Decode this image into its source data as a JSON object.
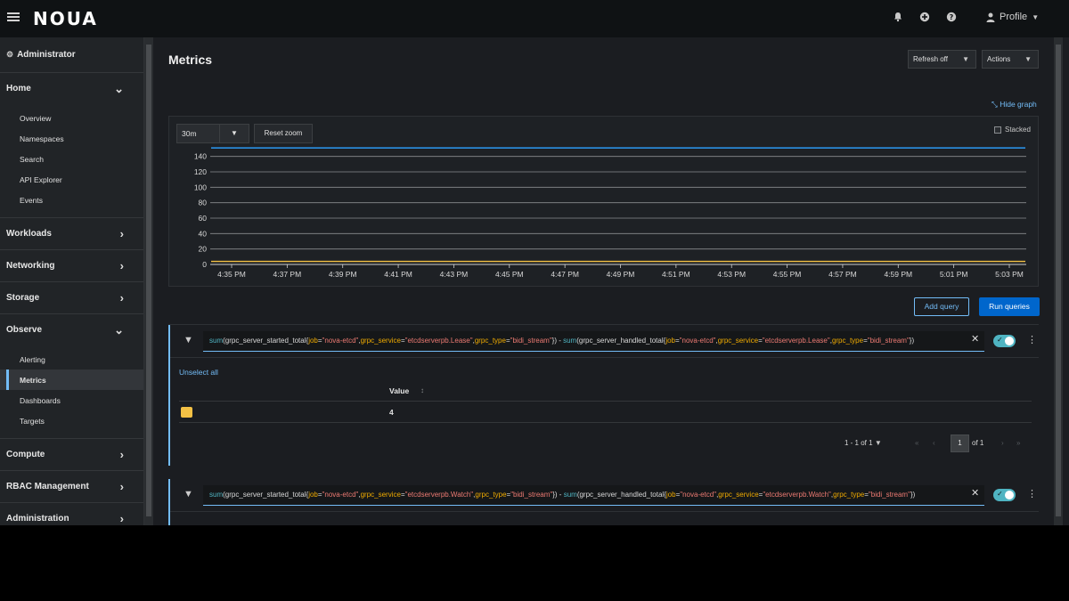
{
  "masthead": {
    "logo": "NOUA",
    "profile_label": "Profile"
  },
  "sidebar": {
    "perspective": "Administrator",
    "groups": [
      {
        "label": "Home",
        "expanded": true,
        "items": [
          "Overview",
          "Namespaces",
          "Search",
          "API Explorer",
          "Events"
        ]
      },
      {
        "label": "Workloads",
        "expanded": false,
        "items": []
      },
      {
        "label": "Networking",
        "expanded": false,
        "items": []
      },
      {
        "label": "Storage",
        "expanded": false,
        "items": []
      },
      {
        "label": "Observe",
        "expanded": true,
        "items": [
          "Alerting",
          "Metrics",
          "Dashboards",
          "Targets"
        ],
        "active": "Metrics"
      },
      {
        "label": "Compute",
        "expanded": false,
        "items": []
      },
      {
        "label": "RBAC Management",
        "expanded": false,
        "items": []
      },
      {
        "label": "Administration",
        "expanded": false,
        "items": []
      }
    ]
  },
  "page": {
    "title": "Metrics",
    "refresh_label": "Refresh off",
    "actions_label": "Actions",
    "hide_graph_label": "Hide graph",
    "time_span": "30m",
    "reset_zoom_label": "Reset zoom",
    "stacked_label": "Stacked",
    "add_query_label": "Add query",
    "run_queries_label": "Run queries"
  },
  "chart_data": {
    "type": "line",
    "title": "",
    "xlabel": "",
    "ylabel": "",
    "x_ticks": [
      "4:35 PM",
      "4:37 PM",
      "4:39 PM",
      "4:41 PM",
      "4:43 PM",
      "4:45 PM",
      "4:47 PM",
      "4:49 PM",
      "4:51 PM",
      "4:53 PM",
      "4:55 PM",
      "4:57 PM",
      "4:59 PM",
      "5:01 PM",
      "5:03 PM"
    ],
    "y_ticks": [
      0,
      20,
      40,
      60,
      80,
      100,
      120,
      140
    ],
    "ylim": [
      0,
      150
    ],
    "grid": true,
    "series": [
      {
        "color": "#2b9af3",
        "values": [
          151,
          151,
          151,
          151,
          151,
          151,
          151,
          151,
          151,
          151,
          151,
          151,
          151,
          151,
          151
        ]
      },
      {
        "color": "#f4c145",
        "values": [
          4,
          4,
          4,
          4,
          4,
          4,
          4,
          4,
          4,
          4,
          4,
          4,
          4,
          4,
          4
        ]
      }
    ]
  },
  "queries": [
    {
      "parts": [
        {
          "t": "sum",
          "c": "fn"
        },
        {
          "t": "(grpc_server_started_total{",
          "c": ""
        },
        {
          "t": "job",
          "c": "lbl"
        },
        {
          "t": "=",
          "c": ""
        },
        {
          "t": "\"nova-etcd\"",
          "c": "str"
        },
        {
          "t": ",",
          "c": ""
        },
        {
          "t": "grpc_service",
          "c": "lbl"
        },
        {
          "t": "=",
          "c": ""
        },
        {
          "t": "\"etcdserverpb.Lease\"",
          "c": "str"
        },
        {
          "t": ",",
          "c": ""
        },
        {
          "t": "grpc_type",
          "c": "lbl"
        },
        {
          "t": "=",
          "c": ""
        },
        {
          "t": "\"bidi_stream\"",
          "c": "str"
        },
        {
          "t": "}) - ",
          "c": ""
        },
        {
          "t": "sum",
          "c": "fn"
        },
        {
          "t": "(grpc_server_handled_total{",
          "c": ""
        },
        {
          "t": "job",
          "c": "lbl"
        },
        {
          "t": "=",
          "c": ""
        },
        {
          "t": "\"nova-etcd\"",
          "c": "str"
        },
        {
          "t": ",",
          "c": ""
        },
        {
          "t": "grpc_service",
          "c": "lbl"
        },
        {
          "t": "=",
          "c": ""
        },
        {
          "t": "\"etcdserverpb.Lease\"",
          "c": "str"
        },
        {
          "t": ",",
          "c": ""
        },
        {
          "t": "grpc_type",
          "c": "lbl"
        },
        {
          "t": "=",
          "c": ""
        },
        {
          "t": "\"bidi_stream\"",
          "c": "str"
        },
        {
          "t": "})",
          "c": ""
        }
      ],
      "unselect_label": "Unselect all",
      "column_header": "Value",
      "rows": [
        {
          "color": "#f4c145",
          "value": "4"
        }
      ],
      "pagination": {
        "range": "1 - 1 of 1",
        "page": "1",
        "of_pages": "of 1"
      }
    },
    {
      "parts": [
        {
          "t": "sum",
          "c": "fn"
        },
        {
          "t": "(grpc_server_started_total{",
          "c": ""
        },
        {
          "t": "job",
          "c": "lbl"
        },
        {
          "t": "=",
          "c": ""
        },
        {
          "t": "\"nova-etcd\"",
          "c": "str"
        },
        {
          "t": ",",
          "c": ""
        },
        {
          "t": "grpc_service",
          "c": "lbl"
        },
        {
          "t": "=",
          "c": ""
        },
        {
          "t": "\"etcdserverpb.Watch\"",
          "c": "str"
        },
        {
          "t": ",",
          "c": ""
        },
        {
          "t": "grpc_type",
          "c": "lbl"
        },
        {
          "t": "=",
          "c": ""
        },
        {
          "t": "\"bidi_stream\"",
          "c": "str"
        },
        {
          "t": "}) - ",
          "c": ""
        },
        {
          "t": "sum",
          "c": "fn"
        },
        {
          "t": "(grpc_server_handled_total{",
          "c": ""
        },
        {
          "t": "job",
          "c": "lbl"
        },
        {
          "t": "=",
          "c": ""
        },
        {
          "t": "\"nova-etcd\"",
          "c": "str"
        },
        {
          "t": ",",
          "c": ""
        },
        {
          "t": "grpc_service",
          "c": "lbl"
        },
        {
          "t": "=",
          "c": ""
        },
        {
          "t": "\"etcdserverpb.Watch\"",
          "c": "str"
        },
        {
          "t": ",",
          "c": ""
        },
        {
          "t": "grpc_type",
          "c": "lbl"
        },
        {
          "t": "=",
          "c": ""
        },
        {
          "t": "\"bidi_stream\"",
          "c": "str"
        },
        {
          "t": "})",
          "c": ""
        }
      ]
    }
  ]
}
